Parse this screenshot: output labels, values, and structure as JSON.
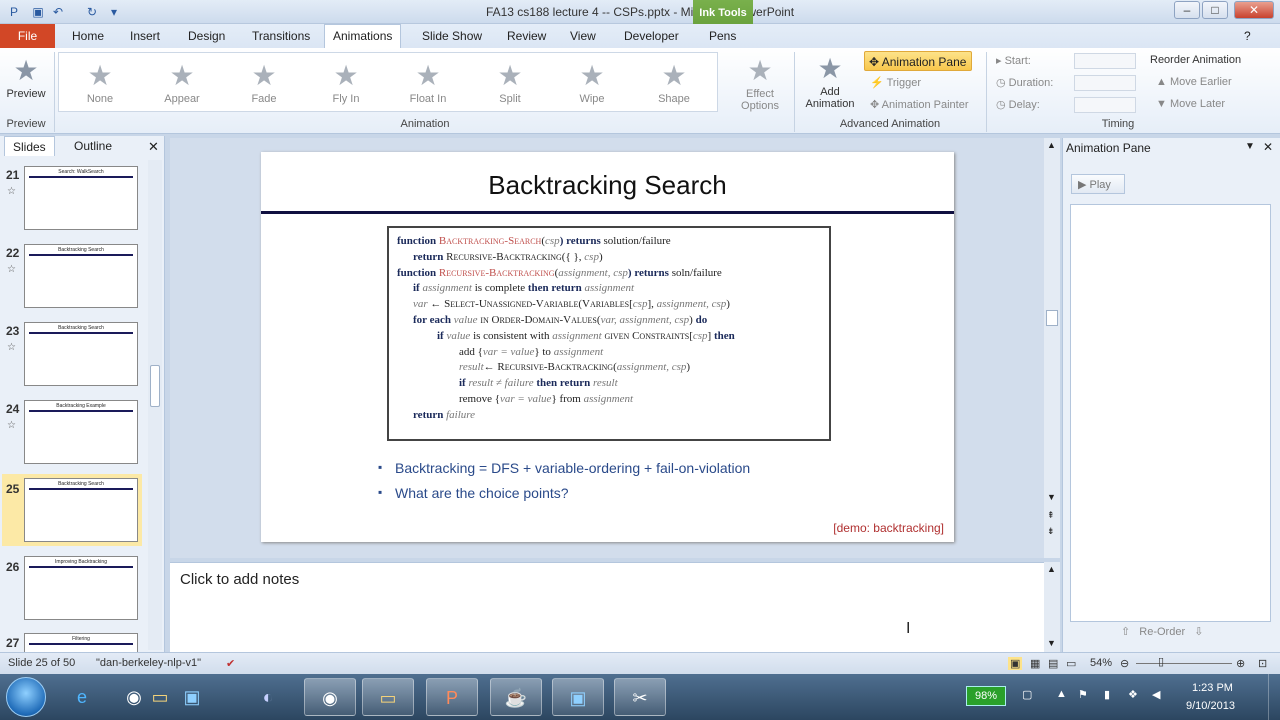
{
  "window": {
    "title": "FA13 cs188 lecture 4 -- CSPs.pptx - Microsoft PowerPoint",
    "contextual_tab": "Ink Tools"
  },
  "tabs": [
    "File",
    "Home",
    "Insert",
    "Design",
    "Transitions",
    "Animations",
    "Slide Show",
    "Review",
    "View",
    "Developer",
    "Pens"
  ],
  "ribbon": {
    "preview": {
      "label": "Preview",
      "group": "Preview"
    },
    "animations": [
      "None",
      "Appear",
      "Fade",
      "Fly In",
      "Float In",
      "Split",
      "Wipe",
      "Shape"
    ],
    "effect_options": "Effect Options",
    "animation_group": "Animation",
    "add_animation": "Add Animation",
    "animation_pane": "Animation Pane",
    "trigger": "Trigger",
    "animation_painter": "Animation Painter",
    "advanced_group": "Advanced Animation",
    "start": "Start:",
    "duration": "Duration:",
    "delay": "Delay:",
    "reorder": "Reorder Animation",
    "move_earlier": "Move Earlier",
    "move_later": "Move Later",
    "timing_group": "Timing"
  },
  "left_pane": {
    "tab_slides": "Slides",
    "tab_outline": "Outline",
    "thumbnails": [
      {
        "num": "21",
        "title": "Search: WalkSearch"
      },
      {
        "num": "22",
        "title": "Backtracking Search"
      },
      {
        "num": "23",
        "title": "Backtracking Search"
      },
      {
        "num": "24",
        "title": "Backtracking Example"
      },
      {
        "num": "25",
        "title": "Backtracking Search"
      },
      {
        "num": "26",
        "title": "Improving Backtracking"
      },
      {
        "num": "27",
        "title": "Filtering"
      }
    ]
  },
  "slide": {
    "title": "Backtracking Search",
    "bullets": [
      "Backtracking = DFS + variable-ordering + fail-on-violation",
      "What are the choice points?"
    ],
    "demo": "[demo: backtracking]",
    "algo": {
      "l1a": "function",
      "l1b": "Backtracking-Search",
      "l1c": "(",
      "l1d": "csp",
      "l1e": ") returns",
      "l1f": "solution/failure",
      "l2a": "return",
      "l2b": "Recursive-Backtracking",
      "l2c": "({ },",
      "l2d": "csp",
      "l2e": ")",
      "l3a": "function",
      "l3b": "Recursive-Backtracking",
      "l3c": "(",
      "l3d": "assignment, csp",
      "l3e": ") returns",
      "l3f": "soln/failure",
      "l4a": "if",
      "l4b": "assignment",
      "l4c": "is complete",
      "l4d": "then return",
      "l4e": "assignment",
      "l5a": "var",
      "l5b": "← Select-Unassigned-Variable(Variables[",
      "l5c": "csp",
      "l5d": "],",
      "l5e": "assignment, csp",
      "l5f": ")",
      "l6a": "for each",
      "l6b": "value",
      "l6c": "in Order-Domain-Values(",
      "l6d": "var, assignment, csp",
      "l6e": ")",
      "l6f": "do",
      "l7a": "if",
      "l7b": "value",
      "l7c": "is consistent with",
      "l7d": "assignment",
      "l7e": "given Constraints[",
      "l7f": "csp",
      "l7g": "]",
      "l7h": "then",
      "l8a": "add {",
      "l8b": "var = value",
      "l8c": "} to",
      "l8d": "assignment",
      "l9a": "result",
      "l9b": "← Recursive-Backtracking(",
      "l9c": "assignment, csp",
      "l9d": ")",
      "l10a": "if",
      "l10b": "result ≠ failure",
      "l10c": "then return",
      "l10d": "result",
      "l11a": "remove {",
      "l11b": "var = value",
      "l11c": "} from",
      "l11d": "assignment",
      "l12a": "return",
      "l12b": "failure"
    }
  },
  "notes": {
    "placeholder": "Click to add notes"
  },
  "anim_pane": {
    "title": "Animation Pane",
    "play": "Play",
    "reorder": "Re-Order"
  },
  "status": {
    "slide": "Slide 25 of 50",
    "theme": "\"dan-berkeley-nlp-v1\"",
    "zoom": "54%"
  },
  "taskbar": {
    "battery": "98%",
    "time": "1:23 PM",
    "date": "9/10/2013"
  }
}
